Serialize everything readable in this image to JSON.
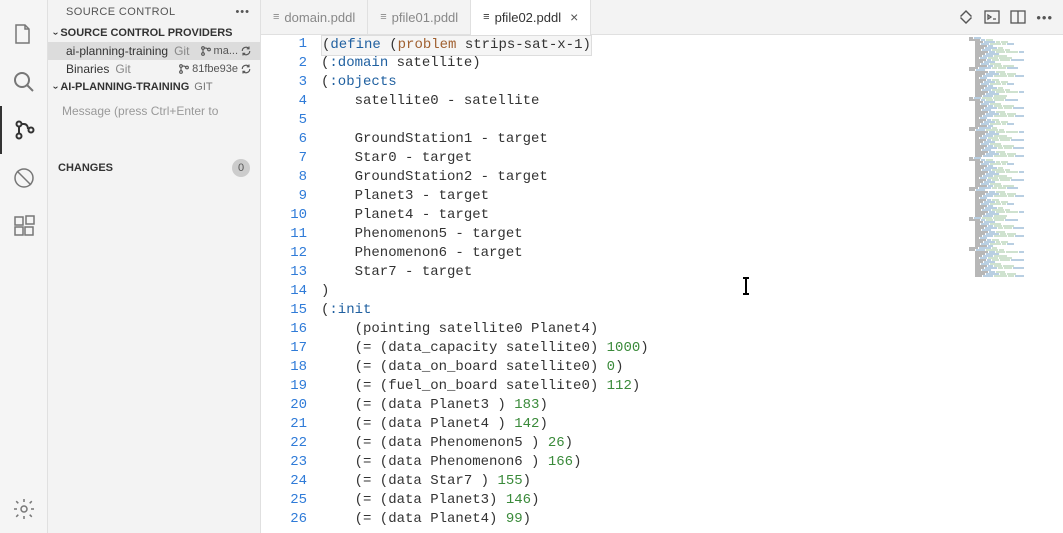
{
  "sidebar": {
    "title": "SOURCE CONTROL",
    "providers_header": "SOURCE CONTROL PROVIDERS",
    "providers": [
      {
        "name": "ai-planning-training",
        "type": "Git",
        "branch": "ma..."
      },
      {
        "name": "Binaries",
        "type": "Git",
        "branch": "81fbe93e"
      }
    ],
    "repo_header": "AI-PLANNING-TRAINING",
    "repo_suffix": "GIT",
    "commit_placeholder": "Message (press Ctrl+Enter to",
    "changes_label": "CHANGES",
    "changes_count": "0"
  },
  "tabs": [
    {
      "label": "domain.pddl",
      "active": false
    },
    {
      "label": "pfile01.pddl",
      "active": false
    },
    {
      "label": "pfile02.pddl",
      "active": true
    }
  ],
  "code": [
    {
      "n": 1,
      "html": "(<span class='kw'>define</span> (<span class='fn'>problem</span> strips-sat-x-1)",
      "wrap": true
    },
    {
      "n": 2,
      "html": "(<span class='kw'>:domain</span> satellite)"
    },
    {
      "n": 3,
      "html": "(<span class='kw'>:objects</span>"
    },
    {
      "n": 4,
      "html": "    satellite0 - satellite"
    },
    {
      "n": 5,
      "html": ""
    },
    {
      "n": 6,
      "html": "    GroundStation1 - target"
    },
    {
      "n": 7,
      "html": "    Star0 - target"
    },
    {
      "n": 8,
      "html": "    GroundStation2 - target"
    },
    {
      "n": 9,
      "html": "    Planet3 - target"
    },
    {
      "n": 10,
      "html": "    Planet4 - target"
    },
    {
      "n": 11,
      "html": "    Phenomenon5 - target"
    },
    {
      "n": 12,
      "html": "    Phenomenon6 - target"
    },
    {
      "n": 13,
      "html": "    Star7 - target"
    },
    {
      "n": 14,
      "html": ")"
    },
    {
      "n": 15,
      "html": "(<span class='kw'>:init</span>"
    },
    {
      "n": 16,
      "html": "    (pointing satellite0 Planet4)"
    },
    {
      "n": 17,
      "html": "    (= (data_capacity satellite0) <span class='num'>1000</span>)"
    },
    {
      "n": 18,
      "html": "    (= (data_on_board satellite0) <span class='num'>0</span>)"
    },
    {
      "n": 19,
      "html": "    (= (fuel_on_board satellite0) <span class='num'>112</span>)"
    },
    {
      "n": 20,
      "html": "    (= (data Planet3 ) <span class='num'>183</span>)"
    },
    {
      "n": 21,
      "html": "    (= (data Planet4 ) <span class='num'>142</span>)"
    },
    {
      "n": 22,
      "html": "    (= (data Phenomenon5 ) <span class='num'>26</span>)"
    },
    {
      "n": 23,
      "html": "    (= (data Phenomenon6 ) <span class='num'>166</span>)"
    },
    {
      "n": 24,
      "html": "    (= (data Star7 ) <span class='num'>155</span>)"
    },
    {
      "n": 25,
      "html": "    (= (data Planet3) <span class='num'>146</span>)"
    },
    {
      "n": 26,
      "html": "    (= (data Planet4) <span class='num'>99</span>)"
    }
  ]
}
